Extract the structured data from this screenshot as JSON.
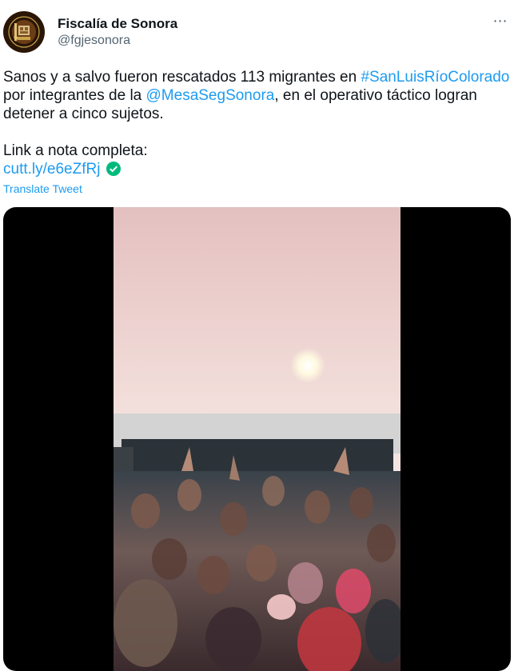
{
  "account": {
    "name": "Fiscalía de Sonora",
    "handle": "@fgjesonora",
    "avatar_icon": "fiscalia-seal-logo"
  },
  "more_icon": "⋯",
  "tweet": {
    "text_1": "Sanos y a salvo fueron rescatados 113 migrantes en ",
    "hashtag": "#SanLuisRíoColorado",
    "text_2": " por integrantes de la ",
    "mention": "@MesaSegSonora",
    "text_3": ", en el operativo táctico logran detener a cinco sujetos.",
    "link_label": "Link a nota completa:",
    "link": "cutt.ly/e6eZfRj",
    "verified_icon": "verified-check-icon"
  },
  "translate_label": "Translate Tweet",
  "colors": {
    "link": "#1d9bf0",
    "verified": "#00ba7c",
    "secondary_text": "#536471",
    "media_background": "#000000"
  }
}
